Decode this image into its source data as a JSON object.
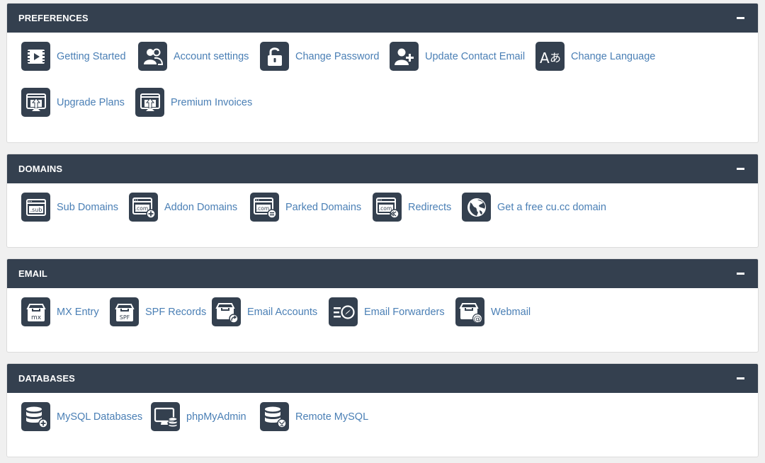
{
  "colors": {
    "header": "#34404f",
    "link": "#4a7fb5",
    "page_bg": "#f0f0f0"
  },
  "sections": [
    {
      "title": "PREFERENCES",
      "items": [
        {
          "label": "Getting Started",
          "icon": "video-play-icon"
        },
        {
          "label": "Account settings",
          "icon": "users-icon"
        },
        {
          "label": "Change Password",
          "icon": "unlock-icon"
        },
        {
          "label": "Update Contact Email",
          "icon": "add-user-icon"
        },
        {
          "label": "Change Language",
          "icon": "translate-icon"
        },
        {
          "label": "Upgrade Plans",
          "icon": "browser-upload-icon"
        },
        {
          "label": "Premium Invoices",
          "icon": "browser-upload-icon"
        }
      ]
    },
    {
      "title": "DOMAINS",
      "items": [
        {
          "label": "Sub Domains",
          "icon": "sub-domain-icon",
          "text": ".sub"
        },
        {
          "label": "Addon Domains",
          "icon": "addon-domain-icon",
          "text": ".com"
        },
        {
          "label": "Parked Domains",
          "icon": "parked-domain-icon",
          "text": ".com"
        },
        {
          "label": "Redirects",
          "icon": "redirect-domain-icon",
          "text": ".com"
        },
        {
          "label": "Get a free cu.cc domain",
          "icon": "globe-icon"
        }
      ]
    },
    {
      "title": "EMAIL",
      "items": [
        {
          "label": "MX Entry",
          "icon": "mailbox-mx-icon",
          "text": "mx"
        },
        {
          "label": "SPF Records",
          "icon": "mailbox-spf-icon",
          "text": "SPF"
        },
        {
          "label": "Email Accounts",
          "icon": "mailbox-share-icon"
        },
        {
          "label": "Email Forwarders",
          "icon": "email-forward-icon"
        },
        {
          "label": "Webmail",
          "icon": "mailbox-at-icon"
        }
      ]
    },
    {
      "title": "DATABASES",
      "items": [
        {
          "label": "MySQL Databases",
          "icon": "database-add-icon"
        },
        {
          "label": "phpMyAdmin",
          "icon": "monitor-database-icon"
        },
        {
          "label": "Remote MySQL",
          "icon": "database-remote-icon"
        }
      ]
    }
  ]
}
